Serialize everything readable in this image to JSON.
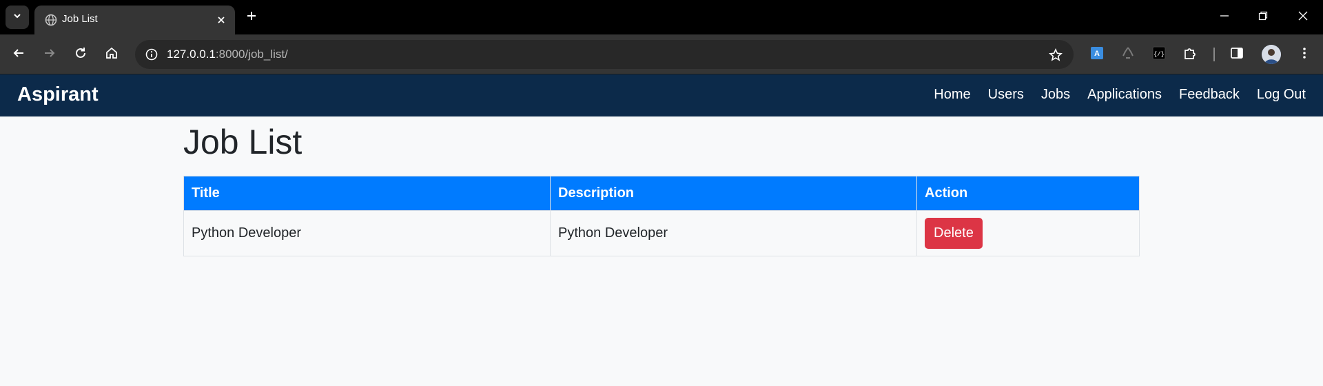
{
  "browser": {
    "tab": {
      "title": "Job List"
    },
    "address_bar": {
      "host": "127.0.0.1",
      "path": ":8000/job_list/"
    }
  },
  "navbar": {
    "brand": "Aspirant",
    "links": [
      "Home",
      "Users",
      "Jobs",
      "Applications",
      "Feedback",
      "Log Out"
    ]
  },
  "page": {
    "title": "Job List",
    "table": {
      "headers": [
        "Title",
        "Description",
        "Action"
      ],
      "rows": [
        {
          "title": "Python Developer",
          "description": "Python Developer",
          "action_label": "Delete"
        }
      ]
    }
  },
  "colors": {
    "navbar_bg": "#0c2a4a",
    "table_header_bg": "#007bff",
    "delete_button": "#dc3545",
    "page_bg": "#f8f9fa"
  }
}
